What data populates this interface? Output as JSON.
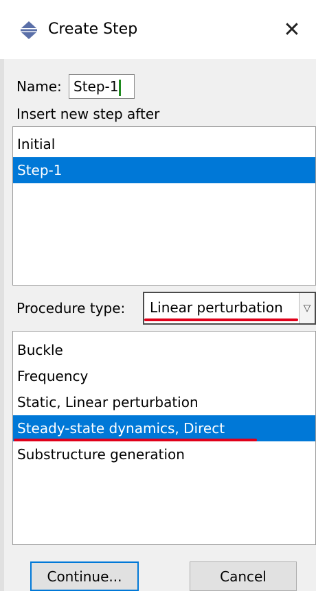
{
  "window": {
    "title": "Create Step",
    "close_glyph": "✕"
  },
  "name_field": {
    "label": "Name:",
    "value": "Step-1"
  },
  "insert_after": {
    "label": "Insert new step after",
    "items": [
      "Initial",
      "Step-1"
    ],
    "selected_index": 1
  },
  "procedure": {
    "label": "Procedure type:",
    "value": "Linear perturbation",
    "items": [
      "Buckle",
      "Frequency",
      "Static, Linear perturbation",
      "Steady-state dynamics, Direct",
      "Substructure generation"
    ],
    "selected_index": 3
  },
  "buttons": {
    "continue": "Continue...",
    "cancel": "Cancel"
  },
  "colors": {
    "selection": "#0078d7",
    "annotation_underline": "#e0001a"
  },
  "icons": {
    "title": "step-arrows-icon",
    "close": "close-icon",
    "dropdown": "chevron-down-icon"
  }
}
